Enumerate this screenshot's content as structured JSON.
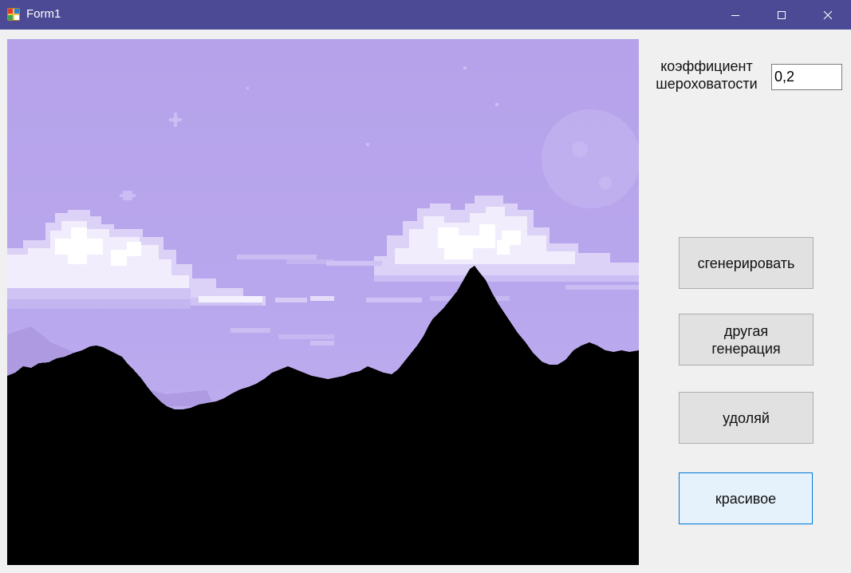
{
  "window": {
    "title": "Form1",
    "icon": "winforms-app-icon",
    "controls": [
      "minimize-icon",
      "maximize-icon",
      "close-icon"
    ]
  },
  "form": {
    "roughness_label": "коэффициент\nшероховатости",
    "roughness_value": "0,2",
    "buttons": {
      "generate": "сгенерировать",
      "other_generation": "другая\nгенерация",
      "delete": "удоляй",
      "beautiful": "красивое"
    }
  },
  "colors": {
    "titlebar": "#4c4a94",
    "sky": "#b6a2ea",
    "mountains": "#000000",
    "focused_button_border": "#0078d7",
    "focused_button_bg": "#e5f1fb"
  }
}
